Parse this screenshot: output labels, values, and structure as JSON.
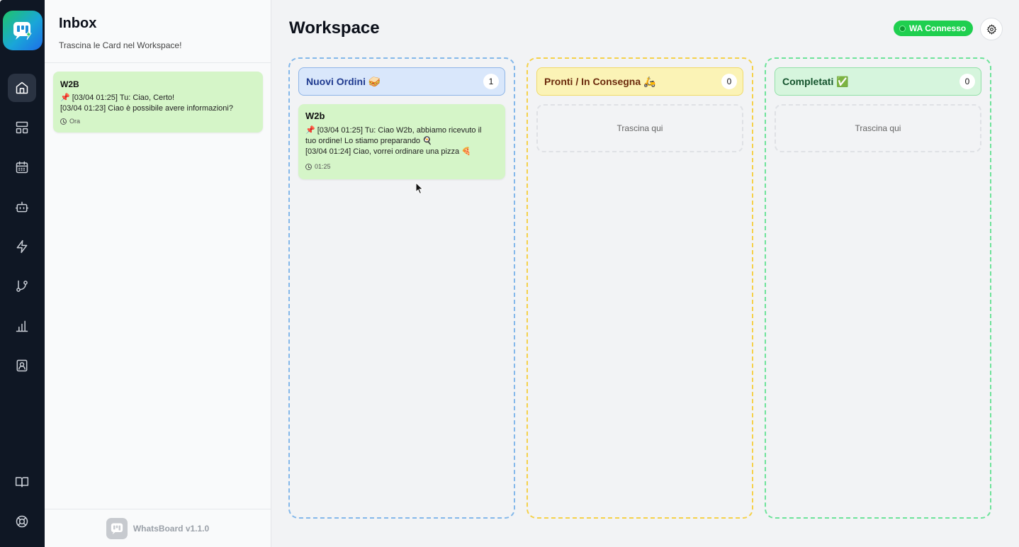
{
  "inbox": {
    "title": "Inbox",
    "subtitle": "Trascina le Card nel Workspace!",
    "chats": [
      {
        "name": "W2B",
        "lines": [
          "📌 [03/04 01:25] Tu: Ciao, Certo!",
          "[03/04 01:23] Ciao è possibile avere informazioni?"
        ],
        "time": "Ora"
      }
    ],
    "footer": "WhatsBoard v1.1.0"
  },
  "workspace": {
    "title": "Workspace",
    "status_badge": "WA Connesso",
    "columns": [
      {
        "title": "Nuovi Ordini 🥪",
        "count": "1",
        "cards": [
          {
            "name": "W2b",
            "lines": [
              "📌 [03/04 01:25] Tu: Ciao W2b, abbiamo ricevuto il",
              "tuo ordine! Lo stiamo preparando 🍳",
              "[03/04 01:24] Ciao, vorrei ordinare una pizza 🍕"
            ],
            "time": "01:25"
          }
        ]
      },
      {
        "title": "Pronti / In Consegna 🛵",
        "count": "0",
        "empty_text": "Trascina qui"
      },
      {
        "title": "Completati ✅",
        "count": "0",
        "empty_text": "Trascina qui"
      }
    ]
  },
  "nav": {
    "items": [
      "home-icon",
      "layout-icon",
      "calendar-icon",
      "bot-icon",
      "zap-icon",
      "git-branch-icon",
      "bar-chart-icon",
      "contact-icon",
      "book-icon",
      "help-icon"
    ],
    "active": "home-icon"
  },
  "colors": {
    "rail": "#0f1724",
    "card": "#d5f5c8",
    "accent_green": "#1fcf4f",
    "col_blue": "#84b8ea",
    "col_yellow": "#f5d14a",
    "col_green": "#6ee39a"
  }
}
